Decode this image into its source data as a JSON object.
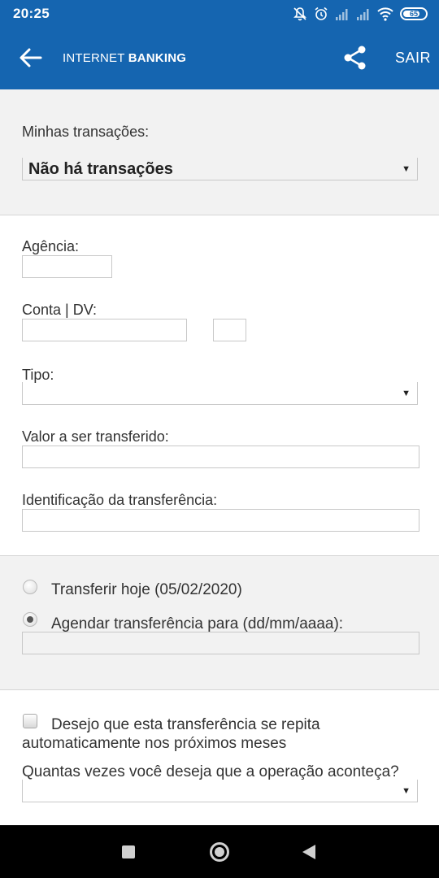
{
  "status_bar": {
    "time": "20:25",
    "battery_level": "65",
    "icons": [
      "bell-off-icon",
      "alarm-icon",
      "signal-icon",
      "signal-icon",
      "wifi-icon",
      "battery-icon"
    ]
  },
  "app_bar": {
    "title_regular": "INTERNET ",
    "title_bold": "BANKING",
    "share_icon": "share-icon",
    "logout_label": "SAIR",
    "color": "#1565b0"
  },
  "transactions": {
    "label": "Minhas transações:",
    "selected": "Não há transações"
  },
  "form": {
    "agency_label": "Agência:",
    "account_label": "Conta | DV:",
    "type_label": "Tipo:",
    "amount_label": "Valor a ser transferido:",
    "identification_label": "Identificação da transferência:"
  },
  "schedule": {
    "today_label": "Transferir hoje (05/02/2020)",
    "today_checked": false,
    "schedule_label": "Agendar transferência para (dd/mm/aaaa):",
    "schedule_checked": true
  },
  "recurrence": {
    "checkbox_label_line1": "Desejo que esta transferência se repita",
    "checkbox_label_line2": "automaticamente nos próximos meses",
    "checked": false,
    "times_label": "Quantas vezes você deseja que a operação aconteça?"
  }
}
